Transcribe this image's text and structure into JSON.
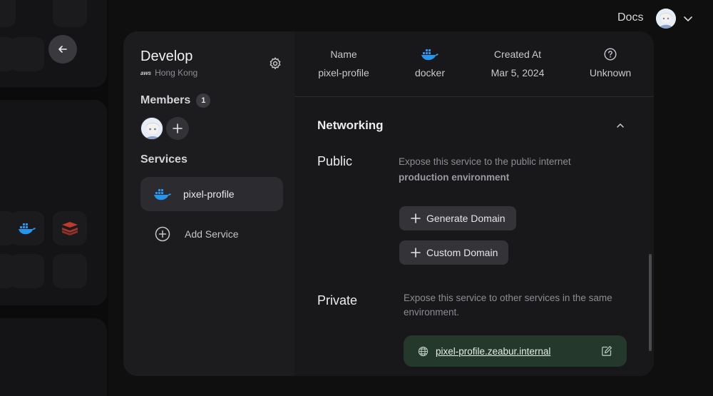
{
  "header": {
    "docs_label": "Docs"
  },
  "project": {
    "name": "Develop",
    "provider": "aws",
    "region": "Hong Kong"
  },
  "members": {
    "label": "Members",
    "count": "1"
  },
  "services": {
    "label": "Services",
    "items": [
      {
        "name": "pixel-profile",
        "icon": "docker-icon"
      }
    ],
    "add_label": "Add Service"
  },
  "service_info": {
    "name_key": "Name",
    "name_value": "pixel-profile",
    "type_value": "docker",
    "created_key": "Created At",
    "created_value": "Mar 5, 2024",
    "status_value": "Unknown"
  },
  "networking": {
    "title": "Networking",
    "public": {
      "label": "Public",
      "description": "Expose this service to the public internet",
      "environment": "production environment",
      "generate_label": "Generate Domain",
      "custom_label": "Custom Domain"
    },
    "private": {
      "label": "Private",
      "description": "Expose this service to other services in the same environment.",
      "hostname": "pixel-profile.zeabur.internal"
    }
  },
  "colors": {
    "docker_blue": "#2496ed",
    "private_bg": "#24382c",
    "accent_red": "#c0392b"
  }
}
